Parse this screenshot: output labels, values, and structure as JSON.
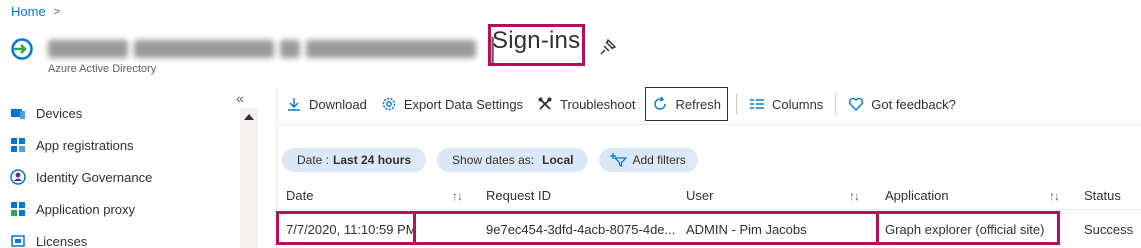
{
  "breadcrumb": {
    "home": "Home",
    "chevron": ">"
  },
  "header": {
    "separator": "|",
    "title": "Sign-ins",
    "subtitle": "Azure Active Directory"
  },
  "sidebar": {
    "collapse_glyph": "«",
    "items": [
      {
        "label": "Devices",
        "icon": "devices-icon"
      },
      {
        "label": "App registrations",
        "icon": "app-registrations-icon"
      },
      {
        "label": "Identity Governance",
        "icon": "identity-governance-icon"
      },
      {
        "label": "Application proxy",
        "icon": "application-proxy-icon"
      },
      {
        "label": "Licenses",
        "icon": "licenses-icon"
      }
    ]
  },
  "toolbar": {
    "download": "Download",
    "export": "Export Data Settings",
    "troubleshoot": "Troubleshoot",
    "refresh": "Refresh",
    "columns": "Columns",
    "feedback": "Got feedback?"
  },
  "filters": {
    "date_label": "Date :",
    "date_value": "Last 24 hours",
    "show_dates_label": "Show dates as:",
    "show_dates_value": "Local",
    "add_filters": "Add filters"
  },
  "table": {
    "columns": [
      "Date",
      "Request ID",
      "User",
      "Application",
      "Status"
    ],
    "sort_glyph": "↑↓",
    "rows": [
      {
        "date": "7/7/2020, 11:10:59 PM",
        "request_id": "9e7ec454-3dfd-4acb-8075-4de...",
        "user": "ADMIN - Pim Jacobs",
        "application": "Graph explorer (official site)",
        "status": "Success"
      }
    ]
  },
  "colors": {
    "accent": "#0078d4",
    "highlight": "#b5115b",
    "pill": "#dae8f8"
  }
}
